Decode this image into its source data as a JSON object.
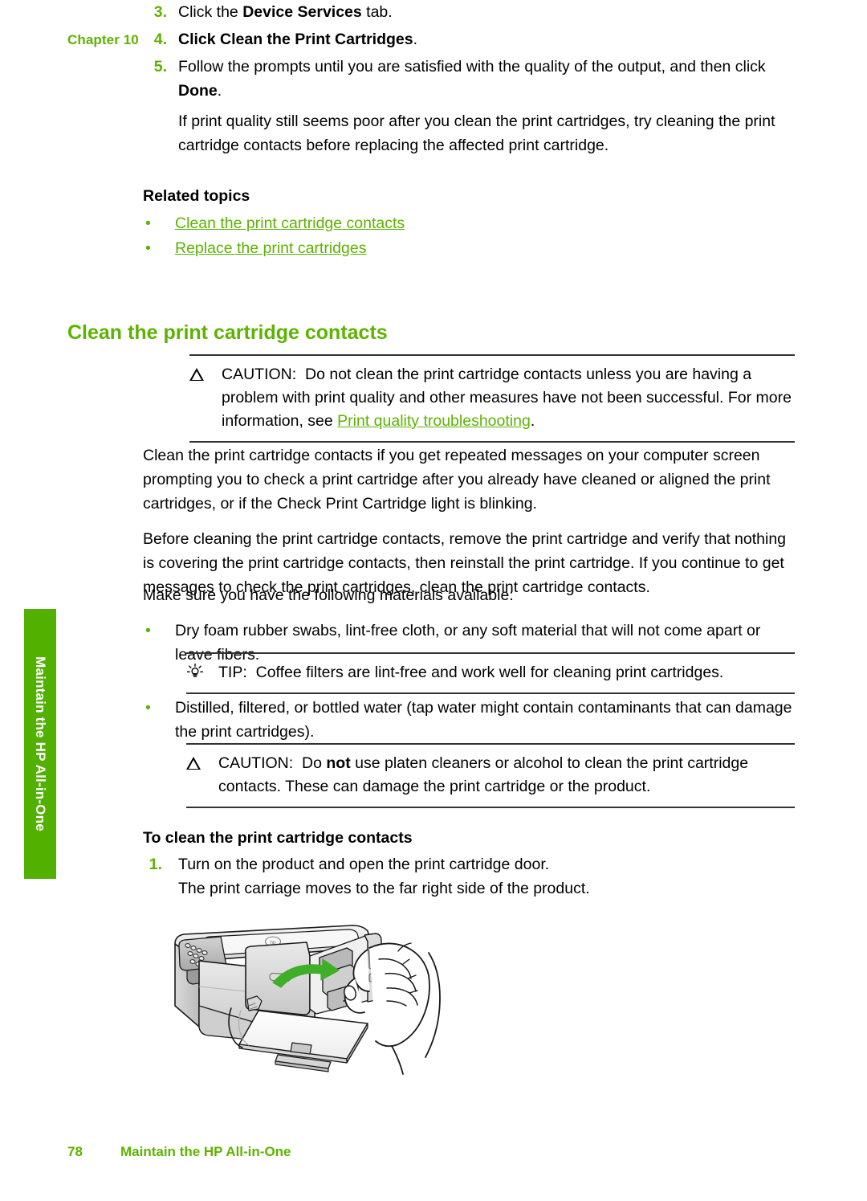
{
  "header": {
    "chapter_label": "Chapter 10"
  },
  "steps_top": [
    {
      "num": "3.",
      "text_before": "Click the ",
      "bold": "Device Services",
      "text_after": " tab."
    },
    {
      "num": "4.",
      "text_before": "Click ",
      "bold": "Clean the Print Cartridges",
      "text_after": "."
    },
    {
      "num": "5.",
      "text_before": "Follow the prompts until you are satisfied with the quality of the output, and then click ",
      "bold": "Done",
      "text_after": ".",
      "follow_up": "If print quality still seems poor after you clean the print cartridges, try cleaning the print cartridge contacts before replacing the affected print cartridge."
    }
  ],
  "related": {
    "title": "Related topics",
    "bullet_glyph": "•",
    "links": [
      "Clean the print cartridge contacts",
      "Replace the print cartridges"
    ]
  },
  "section": {
    "heading": "Clean the print cartridge contacts"
  },
  "caution1": {
    "icon": "caution-triangle-icon",
    "label": "CAUTION:",
    "text_part1": "Do not clean the print cartridge contacts unless you are having a problem with print quality and other measures have not been successful. For more information, see ",
    "link": "Print quality troubleshooting",
    "text_part2": "."
  },
  "body": {
    "para1": "Clean the print cartridge contacts if you get repeated messages on your computer screen prompting you to check a print cartridge after you already have cleaned or aligned the print cartridges, or if the Check Print Cartridge light is blinking.",
    "para2": "Before cleaning the print cartridge contacts, remove the print cartridge and verify that nothing is covering the print cartridge contacts, then reinstall the print cartridge. If you continue to get messages to check the print cartridges, clean the print cartridge contacts.",
    "para3": "Make sure you have the following materials available:",
    "bullet_glyph": "•",
    "bullet1": "Dry foam rubber swabs, lint-free cloth, or any soft material that will not come apart or leave fibers.",
    "bullet2": "Distilled, filtered, or bottled water (tap water might contain contaminants that can damage the print cartridges)."
  },
  "tip": {
    "icon": "lightbulb-icon",
    "label": "TIP:",
    "text": "Coffee filters are lint-free and work well for cleaning print cartridges."
  },
  "caution2": {
    "icon": "caution-triangle-icon",
    "label": "CAUTION:",
    "text_part1": "Do ",
    "bold": "not",
    "text_part2": " use platen cleaners or alcohol to clean the print cartridge contacts. These can damage the print cartridge or the product."
  },
  "procedure": {
    "heading": "To clean the print cartridge contacts",
    "step1_num": "1.",
    "step1_text": "Turn on the product and open the print cartridge door.",
    "step1_followup": "The print carriage moves to the far right side of the product."
  },
  "illustration": {
    "name": "hp-all-in-one-printer-open-cartridge-door-illustration",
    "arrow_color": "#3fae29"
  },
  "side_tab": {
    "label": "Maintain the HP All-in-One",
    "color": "#52b000"
  },
  "footer": {
    "page_number": "78",
    "text": "Maintain the HP All-in-One"
  },
  "colors": {
    "brand_green": "#5cb300",
    "tab_green": "#52b000",
    "rule": "#333333"
  }
}
